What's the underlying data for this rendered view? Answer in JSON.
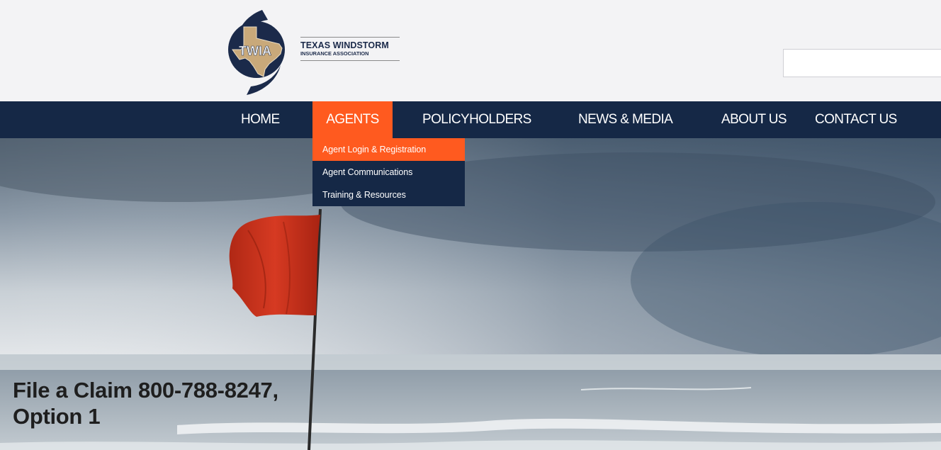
{
  "header": {
    "logo": {
      "emblem_text": "TWIA",
      "name": "TEXAS WINDSTORM",
      "subtitle": "INSURANCE ASSOCIATION"
    },
    "search": {
      "value": "",
      "placeholder": ""
    }
  },
  "nav": {
    "items": [
      {
        "label": "HOME"
      },
      {
        "label": "AGENTS",
        "active": true
      },
      {
        "label": "POLICYHOLDERS"
      },
      {
        "label": "NEWS & MEDIA"
      },
      {
        "label": "ABOUT US"
      },
      {
        "label": "CONTACT US"
      }
    ]
  },
  "dropdown": {
    "items": [
      {
        "label": "Agent Login & Registration",
        "highlighted": true
      },
      {
        "label": "Agent Communications"
      },
      {
        "label": "Training & Resources"
      }
    ]
  },
  "hero": {
    "claim_line1": "File a Claim 800-788-8247,",
    "claim_line2": "Option 1"
  },
  "colors": {
    "navy": "#152846",
    "accent_orange": "#ff5a1f",
    "header_bg": "#f3f3f5",
    "logo_tan": "#c9a97a",
    "flag_red": "#c8321f"
  }
}
